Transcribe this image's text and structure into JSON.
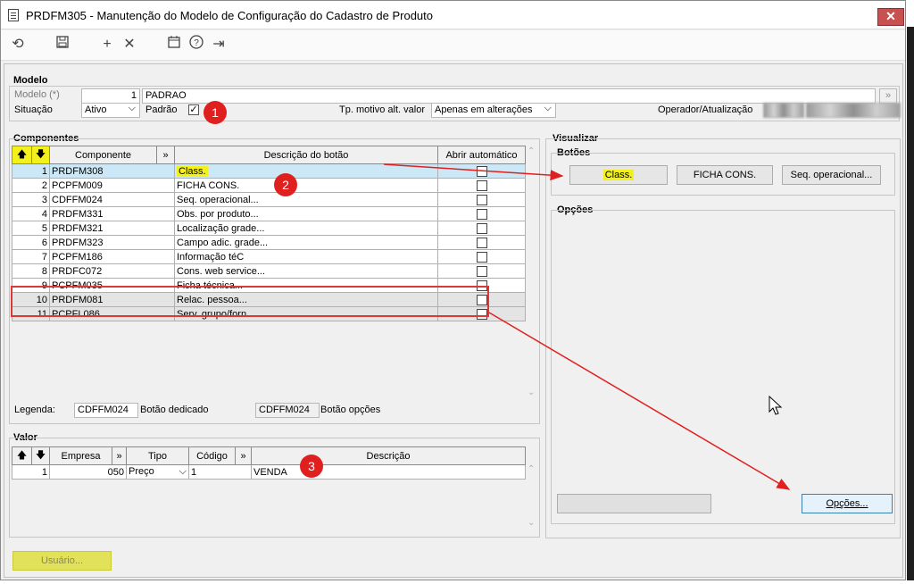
{
  "window": {
    "title": "PRDFM305 - Manutenção do Modelo de Configuração do Cadastro de Produto",
    "close": "✕"
  },
  "modelo": {
    "group_title": "Modelo",
    "modelo_label": "Modelo (*)",
    "modelo_id": "1",
    "modelo_name": "PADRAO",
    "situacao_label": "Situação",
    "situacao_value": "Ativo",
    "padrao_label": "Padrão",
    "padrao_checked": "✓",
    "tp_motivo_label": "Tp. motivo alt. valor",
    "tp_motivo_value": "Apenas em alterações",
    "operador_label": "Operador/Atualização"
  },
  "componentes": {
    "group_title": "Componentes",
    "headers": {
      "componente": "Componente",
      "descricao": "Descrição do botão",
      "abrir": "Abrir automático",
      "expand": "»"
    },
    "rows": [
      {
        "n": "1",
        "comp": "PRDFM308",
        "desc": "Class."
      },
      {
        "n": "2",
        "comp": "PCPFM009",
        "desc": "FICHA CONS."
      },
      {
        "n": "3",
        "comp": "CDFFM024",
        "desc": "Seq. operacional..."
      },
      {
        "n": "4",
        "comp": "PRDFM331",
        "desc": "Obs. por produto..."
      },
      {
        "n": "5",
        "comp": "PRDFM321",
        "desc": "Localização grade..."
      },
      {
        "n": "6",
        "comp": "PRDFM323",
        "desc": "Campo adic. grade..."
      },
      {
        "n": "7",
        "comp": "PCPFM186",
        "desc": "Informação téC"
      },
      {
        "n": "8",
        "comp": "PRDFC072",
        "desc": "Cons. web service..."
      },
      {
        "n": "9",
        "comp": "PCPFM035",
        "desc": "Ficha técnica..."
      },
      {
        "n": "10",
        "comp": "PRDFM081",
        "desc": "Relac. pessoa..."
      },
      {
        "n": "11",
        "comp": "PCPFL086",
        "desc": "Serv. grupo/forn..."
      }
    ],
    "legenda_label": "Legenda:",
    "legenda_dedicado_code": "CDFFM024",
    "legenda_dedicado_label": "Botão dedicado",
    "legenda_opcoes_code": "CDFFM024",
    "legenda_opcoes_label": "Botão opções"
  },
  "valor": {
    "group_title": "Valor",
    "headers": {
      "empresa": "Empresa",
      "tipo": "Tipo",
      "codigo": "Código",
      "descricao": "Descrição",
      "expand": "»"
    },
    "row": {
      "n": "1",
      "empresa": "050",
      "tipo": "Preço",
      "codigo": "1",
      "descricao": "VENDA"
    }
  },
  "visualizar": {
    "group_title": "Visualizar",
    "botoes_title": "Botões",
    "buttons": [
      "Class.",
      "FICHA CONS.",
      "Seq. operacional..."
    ],
    "opcoes_title": "Opções",
    "opcoes_button": "Opções..."
  },
  "footer": {
    "usuario_button": "Usuário..."
  },
  "markers": [
    "1",
    "2",
    "3"
  ],
  "colors": {
    "highlight": "#f3f01c",
    "annotation": "#e0201f",
    "selected_row": "#cce8f6"
  }
}
